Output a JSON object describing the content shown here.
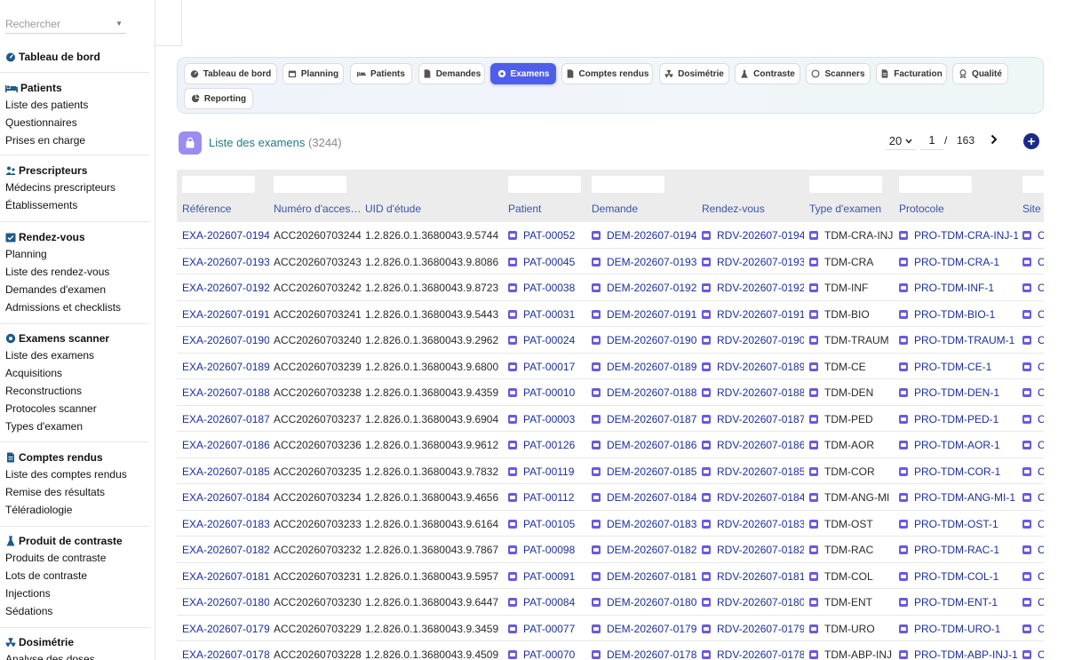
{
  "search": {
    "placeholder": "Rechercher"
  },
  "sidebar": {
    "sections": [
      {
        "title": "Tableau de bord",
        "icon": "dashboard-icon",
        "items": []
      },
      {
        "title": "Patients",
        "icon": "bed-icon",
        "items": [
          "Liste des patients",
          "Questionnaires",
          "Prises en charge"
        ]
      },
      {
        "title": "Prescripteurs",
        "icon": "users-icon",
        "items": [
          "Médecins prescripteurs",
          "Établissements"
        ]
      },
      {
        "title": "Rendez-vous",
        "icon": "calendar-check-icon",
        "items": [
          "Planning",
          "Liste des rendez-vous",
          "Demandes d'examen",
          "Admissions et checklists"
        ]
      },
      {
        "title": "Examens scanner",
        "icon": "scanner-icon",
        "items": [
          "Liste des examens",
          "Acquisitions",
          "Reconstructions",
          "Protocoles scanner",
          "Types d'examen"
        ]
      },
      {
        "title": "Comptes rendus",
        "icon": "document-icon",
        "items": [
          "Liste des comptes rendus",
          "Remise des résultats",
          "Téléradiologie"
        ]
      },
      {
        "title": "Produit de contraste",
        "icon": "flask-icon",
        "items": [
          "Produits de contraste",
          "Lots de contraste",
          "Injections",
          "Sédations"
        ]
      },
      {
        "title": "Dosimétrie",
        "icon": "radiation-icon",
        "items": [
          "Analyse des doses"
        ]
      }
    ]
  },
  "tabs": [
    {
      "label": "Tableau de bord",
      "icon": "dashboard-icon",
      "active": false
    },
    {
      "label": "Planning",
      "icon": "calendar-icon",
      "active": false
    },
    {
      "label": "Patients",
      "icon": "bed-icon",
      "active": false
    },
    {
      "label": "Demandes",
      "icon": "document-icon",
      "active": false
    },
    {
      "label": "Examens",
      "icon": "scanner-icon",
      "active": true
    },
    {
      "label": "Comptes rendus",
      "icon": "document-icon",
      "active": false
    },
    {
      "label": "Dosimétrie",
      "icon": "radiation-icon",
      "active": false
    },
    {
      "label": "Contraste",
      "icon": "flask-icon",
      "active": false
    },
    {
      "label": "Scanners",
      "icon": "circle-icon",
      "active": false
    },
    {
      "label": "Facturation",
      "icon": "invoice-icon",
      "active": false
    },
    {
      "label": "Qualité",
      "icon": "award-icon",
      "active": false
    },
    {
      "label": "Reporting",
      "icon": "chart-pie-icon",
      "active": false
    }
  ],
  "list": {
    "title": "Liste des examens",
    "count": "(3244)"
  },
  "pager": {
    "page_size": "20",
    "page": "1",
    "separator": "/",
    "total_pages": "163"
  },
  "colors": {
    "accent": "#4f5ee8",
    "link": "#1b2f9c",
    "title": "#1f7a86",
    "header_text": "#3a54a8"
  },
  "table": {
    "columns": [
      "Référence",
      "Numéro d'acces…",
      "UID d'étude",
      "Patient",
      "Demande",
      "Rendez-vous",
      "Type d'examen",
      "Protocole",
      "Site"
    ],
    "rows": [
      [
        "EXA-202607-0194",
        "ACC20260703244",
        "1.2.826.0.1.3680043.9.5744…",
        "PAT-00052",
        "DEM-202607-0194",
        "RDV-202607-0194",
        "TDM-CRA-INJ",
        "PRO-TDM-CRA-INJ-1",
        "C"
      ],
      [
        "EXA-202607-0193",
        "ACC20260703243",
        "1.2.826.0.1.3680043.9.8086…",
        "PAT-00045",
        "DEM-202607-0193",
        "RDV-202607-0193",
        "TDM-CRA",
        "PRO-TDM-CRA-1",
        "C"
      ],
      [
        "EXA-202607-0192",
        "ACC20260703242",
        "1.2.826.0.1.3680043.9.8723…",
        "PAT-00038",
        "DEM-202607-0192",
        "RDV-202607-0192",
        "TDM-INF",
        "PRO-TDM-INF-1",
        "C"
      ],
      [
        "EXA-202607-0191",
        "ACC20260703241",
        "1.2.826.0.1.3680043.9.5443…",
        "PAT-00031",
        "DEM-202607-0191",
        "RDV-202607-0191",
        "TDM-BIO",
        "PRO-TDM-BIO-1",
        "C"
      ],
      [
        "EXA-202607-0190",
        "ACC20260703240",
        "1.2.826.0.1.3680043.9.2962…",
        "PAT-00024",
        "DEM-202607-0190",
        "RDV-202607-0190",
        "TDM-TRAUM",
        "PRO-TDM-TRAUM-1",
        "C"
      ],
      [
        "EXA-202607-0189",
        "ACC20260703239",
        "1.2.826.0.1.3680043.9.6800…",
        "PAT-00017",
        "DEM-202607-0189",
        "RDV-202607-0189",
        "TDM-CE",
        "PRO-TDM-CE-1",
        "C"
      ],
      [
        "EXA-202607-0188",
        "ACC20260703238",
        "1.2.826.0.1.3680043.9.4359…",
        "PAT-00010",
        "DEM-202607-0188",
        "RDV-202607-0188",
        "TDM-DEN",
        "PRO-TDM-DEN-1",
        "C"
      ],
      [
        "EXA-202607-0187",
        "ACC20260703237",
        "1.2.826.0.1.3680043.9.6904…",
        "PAT-00003",
        "DEM-202607-0187",
        "RDV-202607-0187",
        "TDM-PED",
        "PRO-TDM-PED-1",
        "C"
      ],
      [
        "EXA-202607-0186",
        "ACC20260703236",
        "1.2.826.0.1.3680043.9.9612…",
        "PAT-00126",
        "DEM-202607-0186",
        "RDV-202607-0186",
        "TDM-AOR",
        "PRO-TDM-AOR-1",
        "C"
      ],
      [
        "EXA-202607-0185",
        "ACC20260703235",
        "1.2.826.0.1.3680043.9.7832…",
        "PAT-00119",
        "DEM-202607-0185",
        "RDV-202607-0185",
        "TDM-COR",
        "PRO-TDM-COR-1",
        "C"
      ],
      [
        "EXA-202607-0184",
        "ACC20260703234",
        "1.2.826.0.1.3680043.9.4656…",
        "PAT-00112",
        "DEM-202607-0184",
        "RDV-202607-0184",
        "TDM-ANG-MI",
        "PRO-TDM-ANG-MI-1",
        "C"
      ],
      [
        "EXA-202607-0183",
        "ACC20260703233",
        "1.2.826.0.1.3680043.9.6164…",
        "PAT-00105",
        "DEM-202607-0183",
        "RDV-202607-0183",
        "TDM-OST",
        "PRO-TDM-OST-1",
        "C"
      ],
      [
        "EXA-202607-0182",
        "ACC20260703232",
        "1.2.826.0.1.3680043.9.7867…",
        "PAT-00098",
        "DEM-202607-0182",
        "RDV-202607-0182",
        "TDM-RAC",
        "PRO-TDM-RAC-1",
        "C"
      ],
      [
        "EXA-202607-0181",
        "ACC20260703231",
        "1.2.826.0.1.3680043.9.5957…",
        "PAT-00091",
        "DEM-202607-0181",
        "RDV-202607-0181",
        "TDM-COL",
        "PRO-TDM-COL-1",
        "C"
      ],
      [
        "EXA-202607-0180",
        "ACC20260703230",
        "1.2.826.0.1.3680043.9.6447…",
        "PAT-00084",
        "DEM-202607-0180",
        "RDV-202607-0180",
        "TDM-ENT",
        "PRO-TDM-ENT-1",
        "C"
      ],
      [
        "EXA-202607-0179",
        "ACC20260703229",
        "1.2.826.0.1.3680043.9.3459…",
        "PAT-00077",
        "DEM-202607-0179",
        "RDV-202607-0179",
        "TDM-URO",
        "PRO-TDM-URO-1",
        "C"
      ],
      [
        "EXA-202607-0178",
        "ACC20260703228",
        "1.2.826.0.1.3680043.9.4509…",
        "PAT-00070",
        "DEM-202607-0178",
        "RDV-202607-0178",
        "TDM-ABP-INJ",
        "PRO-TDM-ABP-INJ-1",
        "C"
      ]
    ]
  }
}
